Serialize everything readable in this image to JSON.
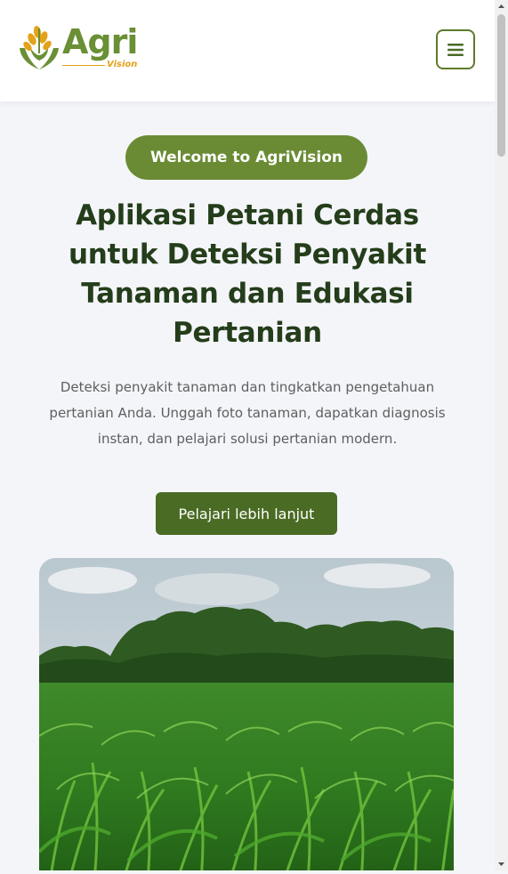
{
  "header": {
    "logo_word": "Agri",
    "logo_sub": "Vision",
    "menu_icon": "hamburger-icon"
  },
  "hero": {
    "badge": "Welcome to AgriVision",
    "title": "Aplikasi Petani Cerdas untuk Deteksi Penyakit Tanaman dan Edukasi Pertanian",
    "description": "Deteksi penyakit tanaman dan tingkatkan pengetahuan pertanian Anda. Unggah foto tanaman, dapatkan diagnosis instan, dan pelajari solusi pertanian modern.",
    "cta_label": "Pelajari lebih lanjut",
    "image_subject": "corn-field-photo"
  },
  "colors": {
    "brand_green": "#6a8b34",
    "dark_green": "#4a6b24",
    "title_green": "#243d1a",
    "accent_gold": "#e3a21a"
  }
}
